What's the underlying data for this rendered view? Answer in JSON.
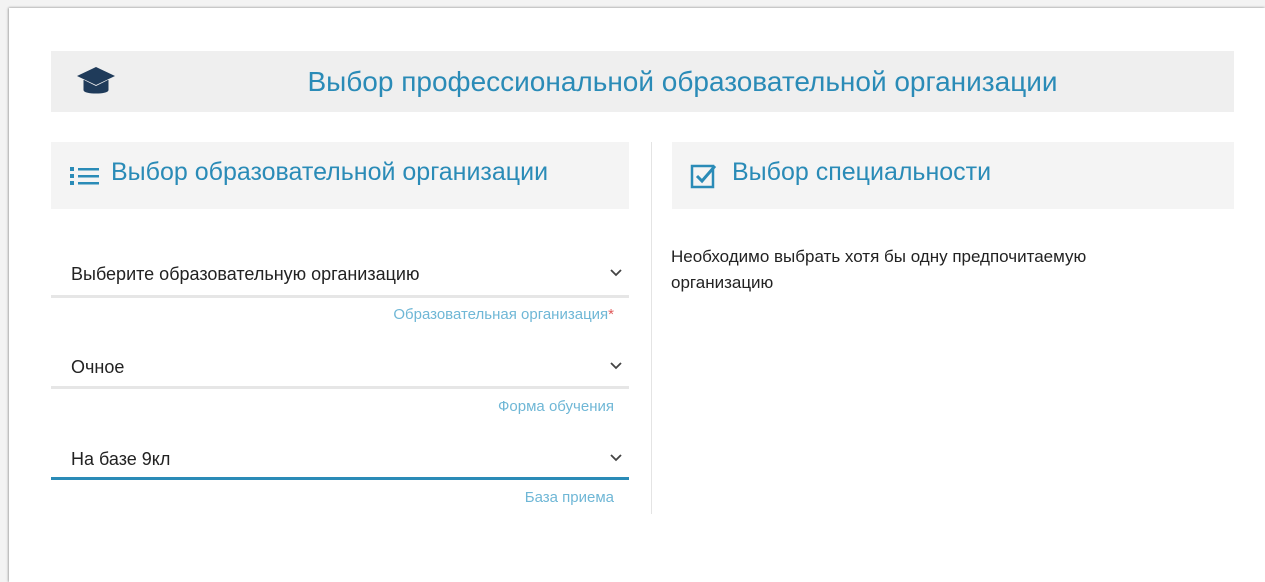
{
  "header": {
    "icon": "graduation-cap-icon",
    "title": "Выбор профессиональной образовательной организации"
  },
  "left_panel": {
    "icon": "list-icon",
    "title": "Выбор образовательной организации",
    "fields": [
      {
        "value": "Выберите образовательную организацию",
        "label": "Образовательная организация",
        "required_mark": "*",
        "icon": "chevron-down-icon"
      },
      {
        "value": "Очное",
        "label": "Форма обучения",
        "icon": "chevron-down-icon"
      },
      {
        "value": "На базе 9кл",
        "label": "База приема",
        "icon": "chevron-down-icon",
        "active": true
      }
    ]
  },
  "right_panel": {
    "icon": "checkbox-checked-icon",
    "title": "Выбор специальности",
    "message": "Необходимо выбрать хотя бы одну предпочитаемую организацию"
  },
  "colors": {
    "accent": "#2a8bb7",
    "hint": "#6fb7d6",
    "required": "#e05a5a",
    "header_bg": "#efefef"
  }
}
